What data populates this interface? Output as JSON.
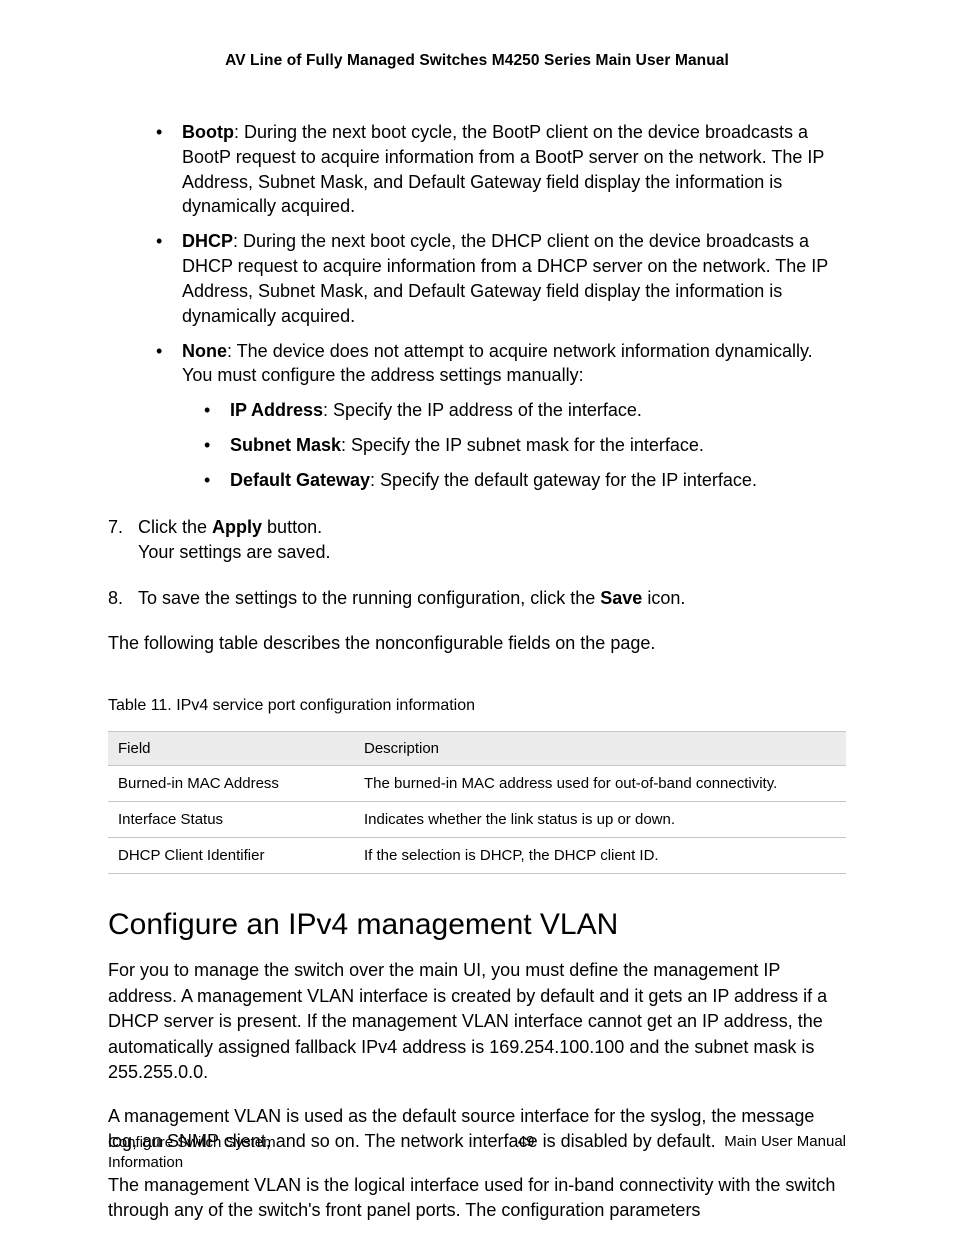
{
  "header": {
    "title": "AV Line of Fully Managed Switches M4250 Series Main User Manual"
  },
  "bullets": {
    "bootp_label": "Bootp",
    "bootp_text": ": During the next boot cycle, the BootP client on the device broadcasts a BootP request to acquire information from a BootP server on the network. The IP Address, Subnet Mask, and Default Gateway field display the information is dynamically acquired.",
    "dhcp_label": "DHCP",
    "dhcp_text": ": During the next boot cycle, the DHCP client on the device broadcasts a DHCP request to acquire information from a DHCP server on the network. The IP Address, Subnet Mask, and Default Gateway field display the information is dynamically acquired.",
    "none_label": "None",
    "none_text": ": The device does not attempt to acquire network information dynamically. You must configure the address settings manually:",
    "inner_ip_label": "IP Address",
    "inner_ip_text": ": Specify the IP address of the interface.",
    "inner_subnet_label": "Subnet Mask",
    "inner_subnet_text": ": Specify the IP subnet mask for the interface.",
    "inner_gw_label": "Default Gateway",
    "inner_gw_text": ": Specify the default gateway for the IP interface."
  },
  "steps": {
    "s7_num": "7.",
    "s7_pre": "Click the ",
    "s7_bold": "Apply",
    "s7_post": " button.",
    "s7_line2": "Your settings are saved.",
    "s8_num": "8.",
    "s8_pre": "To save the settings to the running configuration, click the ",
    "s8_bold": "Save",
    "s8_post": " icon."
  },
  "para_intro_table": "The following table describes the nonconfigurable fields on the page.",
  "table": {
    "caption": "Table 11. IPv4 service port configuration information",
    "head_field": "Field",
    "head_desc": "Description",
    "rows": [
      {
        "field": "Burned-in MAC Address",
        "desc": "The burned-in MAC address used for out-of-band connectivity."
      },
      {
        "field": "Interface Status",
        "desc": "Indicates whether the link status is up or down."
      },
      {
        "field": "DHCP Client Identifier",
        "desc": "If the selection is DHCP, the DHCP client ID."
      }
    ]
  },
  "section_heading": "Configure an IPv4 management VLAN",
  "section_p1": "For you to manage the switch over the main UI, you must define the management IP address. A management VLAN interface is created by default and it gets an IP address if a DHCP server is present. If the management VLAN interface cannot get an IP address, the automatically assigned fallback IPv4 address is 169.254.100.100 and the subnet mask is 255.255.0.0.",
  "section_p2": "A management VLAN is used as the default source interface for the syslog, the message log, an SNMP client, and so on. The network interface is disabled by default.",
  "section_p3": "The management VLAN is the logical interface used for in-band connectivity with the switch through any of the switch's front panel ports. The configuration parameters",
  "footer": {
    "left": "Configure Switch System Information",
    "center": "49",
    "right": "Main User Manual"
  }
}
